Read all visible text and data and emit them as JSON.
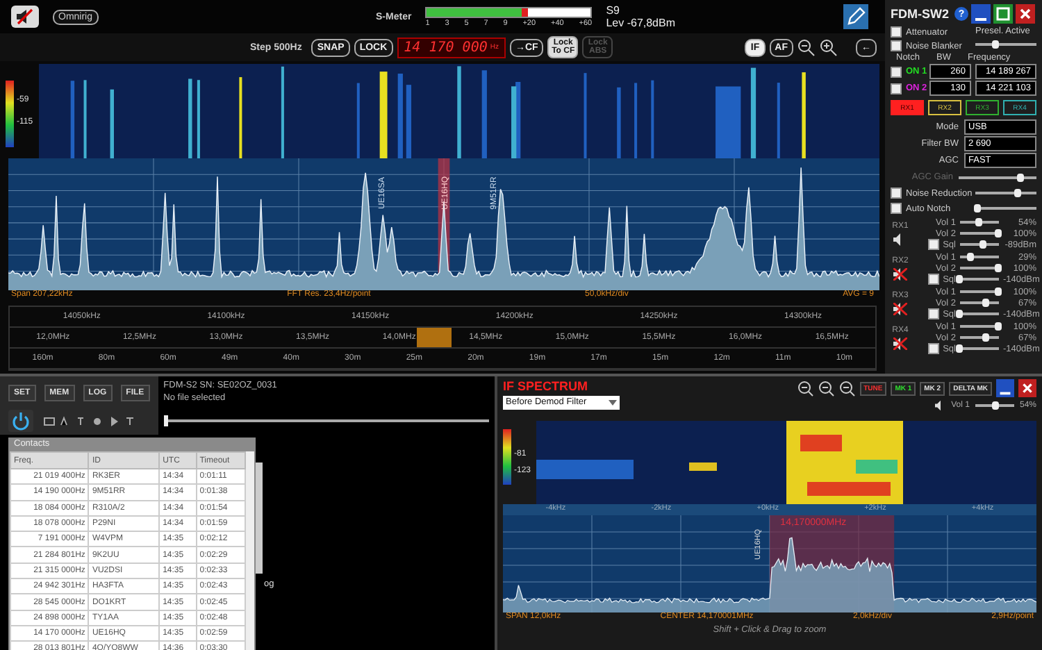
{
  "top_bar": {
    "omnirig_button": "Omnirig",
    "s_meter": {
      "label": "S-Meter",
      "level": 0.62,
      "ticks": [
        "1",
        "3",
        "5",
        "7",
        "9",
        "+20",
        "+40",
        "+60"
      ],
      "reading": "S9",
      "level_text": "Lev -67,8dBm"
    }
  },
  "control_bar": {
    "step": "Step 500Hz",
    "buttons": [
      "SNAP",
      "LOCK"
    ],
    "frequency": "14 170 000",
    "frequency_unit": "Hz",
    "to_cf": "→CF",
    "lock_buttons": [
      {
        "label": "Lock To CF",
        "disabled": false
      },
      {
        "label": "Lock ABS",
        "disabled": true
      }
    ],
    "modes": [
      {
        "label": "IF",
        "selected": true
      },
      {
        "label": "AF",
        "selected": false
      }
    ],
    "back_button": "←"
  },
  "waterfall": {
    "scale_labels": [
      "-59",
      "-115"
    ]
  },
  "spectrum": {
    "markers": [
      {
        "label": "UE16SA",
        "selected": false
      },
      {
        "label": "UE16HQ",
        "selected": true
      },
      {
        "label": "9M51RR",
        "selected": false
      }
    ],
    "footer": [
      "Span 207,22kHz",
      "FFT Res. 23,4Hz/point",
      "50,0kHz/div",
      "AVG = 9"
    ]
  },
  "scale": {
    "khz": [
      "14050kHz",
      "14100kHz",
      "14150kHz",
      "14200kHz",
      "14250kHz",
      "14300kHz"
    ],
    "mhz": [
      "12,0MHz",
      "12,5MHz",
      "13,0MHz",
      "13,5MHz",
      "14,0MHz",
      "14,5MHz",
      "15,0MHz",
      "15,5MHz",
      "16,0MHz",
      "16,5MHz"
    ],
    "bands": [
      "160m",
      "80m",
      "60m",
      "49m",
      "40m",
      "30m",
      "25m",
      "20m",
      "19m",
      "17m",
      "15m",
      "12m",
      "11m",
      "10m"
    ]
  },
  "receiver_panel": {
    "title": "FDM-SW2",
    "help": "?",
    "checks": [
      {
        "label": "Attenuator",
        "checked": false
      },
      {
        "label": "Noise Blanker",
        "checked": false
      }
    ],
    "presel": {
      "label": "Presel. Active",
      "level": 0.35
    },
    "notch_headers": [
      "Notch",
      "BW",
      "Frequency"
    ],
    "notches": [
      {
        "label": "ON 1",
        "checked": false,
        "color": "#22dd22",
        "bw": "260",
        "frequency": "14 189 267"
      },
      {
        "label": "ON 2",
        "checked": false,
        "color": "#dd22dd",
        "bw": "130",
        "frequency": "14 221 103"
      }
    ],
    "rx_buttons": [
      {
        "label": "RX1",
        "selected": true,
        "color": "#ff2020"
      },
      {
        "label": "RX2",
        "selected": false,
        "color": "#d8c040"
      },
      {
        "label": "RX3",
        "selected": false,
        "color": "#30b030"
      },
      {
        "label": "RX4",
        "selected": false,
        "color": "#30b0b0"
      }
    ],
    "mode": {
      "label": "Mode",
      "value": "USB"
    },
    "filter_bw": {
      "label": "Filter BW",
      "value": "2 690"
    },
    "agc": {
      "label": "AGC",
      "value": "FAST"
    },
    "agc_gain": {
      "label": "AGC Gain",
      "disabled": true,
      "level": 0.8
    },
    "dsp": [
      {
        "label": "Noise Reduction",
        "checked": false,
        "level": 0.7
      },
      {
        "label": "Auto Notch",
        "checked": false,
        "level": 0.05
      }
    ],
    "receivers": [
      {
        "label": "RX1",
        "muted": false,
        "sliders": [
          {
            "label": "Vol 1",
            "level": 0.5,
            "reading": "54%"
          },
          {
            "label": "Vol 2",
            "level": 1,
            "reading": "100%"
          },
          {
            "label": "Sql",
            "level": 0.6,
            "reading": "-89dBm",
            "checked": false
          }
        ]
      },
      {
        "label": "RX2",
        "muted": true,
        "sliders": [
          {
            "label": "Vol 1",
            "level": 0.3,
            "reading": "29%"
          },
          {
            "label": "Vol 2",
            "level": 1,
            "reading": "100%"
          },
          {
            "label": "Sql",
            "level": 0,
            "reading": "-140dBm",
            "checked": false
          }
        ]
      },
      {
        "label": "RX3",
        "muted": true,
        "sliders": [
          {
            "label": "Vol 1",
            "level": 1,
            "reading": "100%"
          },
          {
            "label": "Vol 2",
            "level": 0.67,
            "reading": "67%"
          },
          {
            "label": "Sql",
            "level": 0,
            "reading": "-140dBm",
            "checked": false
          }
        ]
      },
      {
        "label": "RX4",
        "muted": true,
        "sliders": [
          {
            "label": "Vol 1",
            "level": 1,
            "reading": "100%"
          },
          {
            "label": "Vol 2",
            "level": 0.67,
            "reading": "67%"
          },
          {
            "label": "Sql",
            "level": 0,
            "reading": "-140dBm",
            "checked": false
          }
        ]
      }
    ]
  },
  "bottom_left": {
    "buttons": [
      "SET",
      "MEM",
      "LOG",
      "FILE"
    ],
    "device_info": "FDM-S2 SN: SE02OZ_0031",
    "file_status": "No file selected",
    "playback": {
      "level": 0
    },
    "background_fragment": "og",
    "contacts": {
      "title": "Contacts",
      "columns": [
        "Freq.",
        "ID",
        "UTC",
        "Timeout"
      ],
      "rows": [
        [
          "21 019 400Hz",
          "RK3ER",
          "14:34",
          "0:01:11"
        ],
        [
          "14 190 000Hz",
          "9M51RR",
          "14:34",
          "0:01:38"
        ],
        [
          "18 084 000Hz",
          "R310A/2",
          "14:34",
          "0:01:54"
        ],
        [
          "18 078 000Hz",
          "P29NI",
          "14:34",
          "0:01:59"
        ],
        [
          "7 191 000Hz",
          "W4VPM",
          "14:35",
          "0:02:12"
        ],
        [
          "21 284 801Hz",
          "9K2UU",
          "14:35",
          "0:02:29"
        ],
        [
          "21 315 000Hz",
          "VU2DSI",
          "14:35",
          "0:02:33"
        ],
        [
          "24 942 301Hz",
          "HA3FTA",
          "14:35",
          "0:02:43"
        ],
        [
          "28 545 000Hz",
          "DO1KRT",
          "14:35",
          "0:02:45"
        ],
        [
          "24 898 000Hz",
          "TY1AA",
          "14:35",
          "0:02:48"
        ],
        [
          "14 170 000Hz",
          "UE16HQ",
          "14:35",
          "0:02:59"
        ],
        [
          "28 013 801Hz",
          "4O/YO8WW",
          "14:36",
          "0:03:30"
        ]
      ]
    }
  },
  "if_spectrum": {
    "title": "IF SPECTRUM",
    "source": "Before Demod Filter",
    "buttons": [
      {
        "label": "TUNE",
        "color": "#ff3030"
      },
      {
        "label": "MK 1",
        "color": "#30e030"
      },
      {
        "label": "MK 2",
        "color": "#e0e0e0"
      },
      {
        "label": "DELTA MK",
        "color": "#e0e0e0"
      }
    ],
    "volume": {
      "label": "Vol 1",
      "level": 0.54,
      "reading": "54%"
    },
    "scale_labels": [
      "-81",
      "-123"
    ],
    "offsets": [
      "-4kHz",
      "-2kHz",
      "+0kHz",
      "+2kHz",
      "+4kHz"
    ],
    "center_label": "14,170000MHz",
    "marker": "UE16HQ",
    "footer": [
      "SPAN 12,0kHz",
      "CENTER 14,170001MHz",
      "2,0kHz/div",
      "2,9Hz/point"
    ],
    "hint": "Shift + Click & Drag to zoom"
  }
}
